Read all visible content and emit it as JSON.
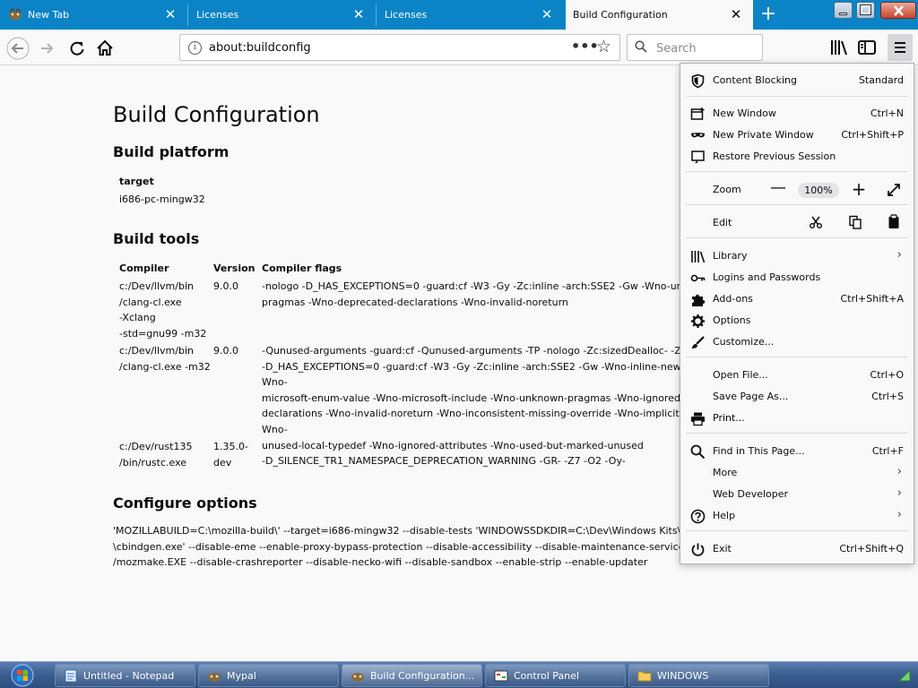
{
  "tabs": [
    {
      "title": "New Tab",
      "close_glyph": "✕"
    },
    {
      "title": "Licenses",
      "close_glyph": "✕"
    },
    {
      "title": "Licenses",
      "close_glyph": "✕"
    },
    {
      "title": "Build Configuration",
      "close_glyph": "✕",
      "selected": true
    }
  ],
  "new_tab_glyph": "+",
  "navbar": {
    "url": "about:buildconfig",
    "page_actions_glyph": "•••",
    "bookmark_glyph": "☆",
    "search_placeholder": "Search"
  },
  "page": {
    "title": "Build Configuration",
    "platform_heading": "Build platform",
    "platform_header": "target",
    "platform_value": "i686-pc-mingw32",
    "tools_heading": "Build tools",
    "tools_headers": [
      "Compiler",
      "Version",
      "Compiler flags"
    ],
    "tools_rows": [
      {
        "compiler": "c:/Dev/llvm/bin\n/clang-cl.exe\n-Xclang\n-std=gnu99 -m32",
        "version": "9.0.0",
        "flags": "-nologo -D_HAS_EXCEPTIONS=0 -guard:cf -W3 -Gy -Zc:inline -arch:SSE2 -Gw -Wno-unknown-pragmas -Wno-ignored-\npragmas -Wno-deprecated-declarations -Wno-invalid-noreturn"
      },
      {
        "compiler": "c:/Dev/llvm/bin\n/clang-cl.exe -m32",
        "version": "9.0.0",
        "flags": "-Qunused-arguments -guard:cf -Qunused-arguments -TP -nologo -Zc:sizedDealloc- -Zc:threadSafeInit-\n-D_HAS_EXCEPTIONS=0 -guard:cf -W3 -Gy -Zc:inline -arch:SSE2 -Gw -Wno-inline-new-delete -Wno-invalid-offsetof -Wno-\nmicrosoft-enum-value -Wno-microsoft-include -Wno-unknown-pragmas -Wno-ignored-pragmas -Wno-deprecated-\ndeclarations -Wno-invalid-noreturn -Wno-inconsistent-missing-override -Wno-implicit-exception-spec-mismatch -Wno-\nunused-local-typedef -Wno-ignored-attributes -Wno-used-but-marked-unused\n-D_SILENCE_TR1_NAMESPACE_DEPRECATION_WARNING -GR- -Z7 -O2 -Oy-"
      },
      {
        "compiler": "c:/Dev/rust135\n/bin/rustc.exe",
        "version": "1.35.0-\ndev",
        "flags": ""
      }
    ],
    "configure_heading": "Configure options",
    "configure_text": "'MOZILLABUILD=C:\\mozilla-build\\' --target=i686-mingw32 --disable-tests 'WINDOWSSDKDIR=C:\\Dev\\Windows Kits\\10\\' 'CBINDGEN=C:\\Dev\\git\\cbindgen\n\\cbindgen.exe' --disable-eme --enable-proxy-bypass-protection --disable-accessibility --disable-maintenance-service MAKE=C:\\mozilla-build\\bin\n/mozmake.EXE --disable-crashreporter --disable-necko-wifi --disable-sandbox --enable-strip --enable-updater"
  },
  "app_menu": {
    "content_blocking": {
      "label": "Content Blocking",
      "value": "Standard"
    },
    "new_window": {
      "label": "New Window",
      "shortcut": "Ctrl+N"
    },
    "new_private_window": {
      "label": "New Private Window",
      "shortcut": "Ctrl+Shift+P"
    },
    "restore_session": {
      "label": "Restore Previous Session"
    },
    "zoom": {
      "label": "Zoom",
      "minus": "—",
      "level": "100%",
      "plus": "+"
    },
    "edit": {
      "label": "Edit"
    },
    "library": {
      "label": "Library",
      "arrow": "›"
    },
    "logins": {
      "label": "Logins and Passwords"
    },
    "addons": {
      "label": "Add-ons",
      "shortcut": "Ctrl+Shift+A"
    },
    "options": {
      "label": "Options"
    },
    "customize": {
      "label": "Customize..."
    },
    "open_file": {
      "label": "Open File...",
      "shortcut": "Ctrl+O"
    },
    "save_page": {
      "label": "Save Page As...",
      "shortcut": "Ctrl+S"
    },
    "print": {
      "label": "Print..."
    },
    "find": {
      "label": "Find in This Page...",
      "shortcut": "Ctrl+F"
    },
    "more": {
      "label": "More",
      "arrow": "›"
    },
    "web_developer": {
      "label": "Web Developer",
      "arrow": "›"
    },
    "help": {
      "label": "Help",
      "arrow": "›"
    },
    "exit": {
      "label": "Exit",
      "shortcut": "Ctrl+Shift+Q"
    }
  },
  "taskbar": [
    {
      "label": "Untitled - Notepad"
    },
    {
      "label": "Mypal"
    },
    {
      "label": "Build Configuration...",
      "active": true
    },
    {
      "label": "Control Panel"
    },
    {
      "label": "WINDOWS"
    }
  ],
  "colors": {
    "tabstrip": "#0a84c6",
    "taskbar": "#3a5d8f",
    "page_bg": "#f9f9fa"
  }
}
